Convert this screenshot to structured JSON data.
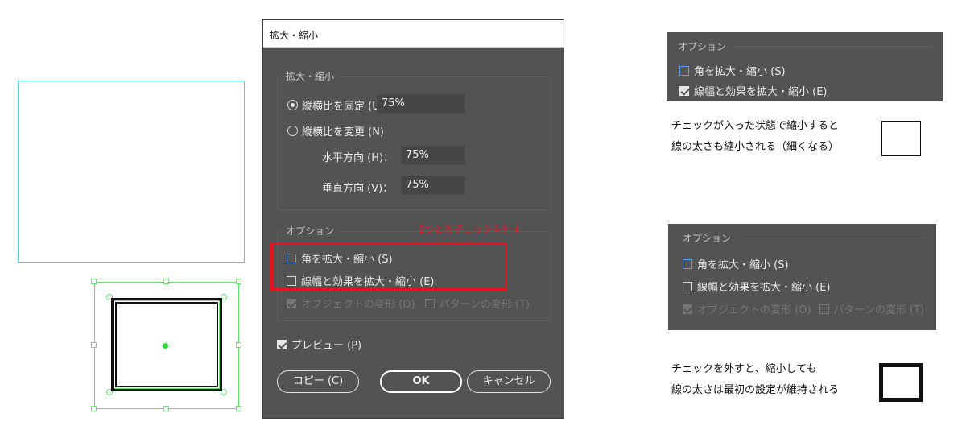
{
  "dialog": {
    "title": "拡大・縮小",
    "scale_group": {
      "title": "拡大・縮小",
      "uniform_label": "縦横比を固定 (U)：",
      "uniform_value": "75%",
      "nonuniform_label": "縦横比を変更 (N)",
      "horizontal_label": "水平方向 (H)：",
      "horizontal_value": "75%",
      "vertical_label": "垂直方向 (V)：",
      "vertical_value": "75%"
    },
    "options_group": {
      "title": "オプション",
      "scale_corners": "角を拡大・縮小 (S)",
      "scale_strokes": "線幅と効果を拡大・縮小 (E)",
      "transform_objects": "オブジェクトの変形 (O)",
      "transform_patterns": "パターンの変形 (T)"
    },
    "preview_label": "プレビュー (P)",
    "buttons": {
      "copy": "コピー (C)",
      "ok": "OK",
      "cancel": "キャンセル"
    }
  },
  "annotation": {
    "uncheck_note": "2つともチェックを外す"
  },
  "crop_checked": {
    "title": "オプション",
    "scale_corners": "角を拡大・縮小 (S)",
    "scale_strokes": "線幅と効果を拡大・縮小 (E)"
  },
  "note_checked": {
    "line1": "チェックが入った状態で縮小すると",
    "line2": "線の太さも縮小される（細くなる）"
  },
  "crop_unchecked": {
    "title": "オプション",
    "scale_corners": "角を拡大・縮小 (S)",
    "scale_strokes": "線幅と効果を拡大・縮小 (E)",
    "transform_objects": "オブジェクトの変形 (O)",
    "transform_patterns": "パターンの変形 (T)"
  },
  "note_unchecked": {
    "line1": "チェックを外すと、縮小しても",
    "line2": "線の太さは最初の設定が維持される"
  },
  "colors": {
    "dialog_bg": "#535353",
    "selection": "#5ee86a",
    "shape_outline": "#39d5e6",
    "highlight": "#e8121e",
    "focus": "#5b9bf0"
  }
}
